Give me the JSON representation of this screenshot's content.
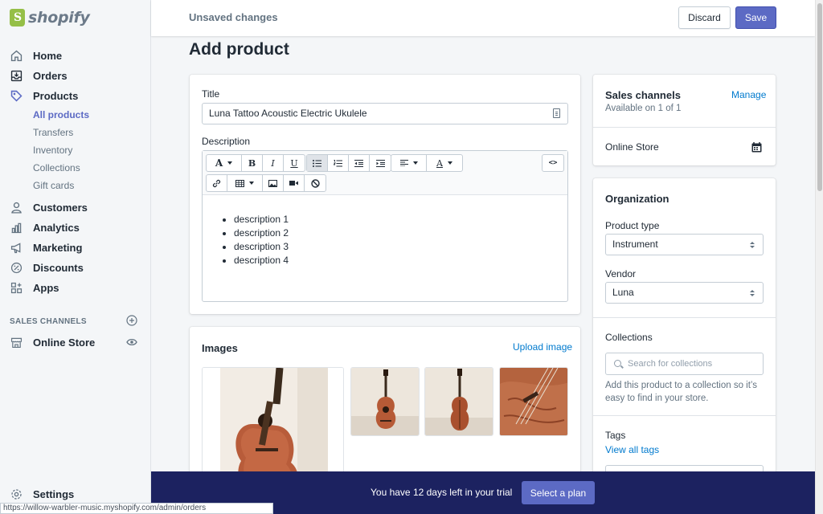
{
  "brand": {
    "name": "shopify"
  },
  "topbar": {
    "status": "Unsaved changes",
    "discard_label": "Discard",
    "save_label": "Save"
  },
  "sidebar": {
    "items": [
      {
        "label": "Home",
        "icon": "home-icon"
      },
      {
        "label": "Orders",
        "icon": "orders-icon"
      },
      {
        "label": "Products",
        "icon": "tag-icon"
      }
    ],
    "product_subitems": [
      "All products",
      "Transfers",
      "Inventory",
      "Collections",
      "Gift cards"
    ],
    "items2": [
      {
        "label": "Customers",
        "icon": "person-icon"
      },
      {
        "label": "Analytics",
        "icon": "bar-chart-icon"
      },
      {
        "label": "Marketing",
        "icon": "megaphone-icon"
      },
      {
        "label": "Discounts",
        "icon": "discount-icon"
      },
      {
        "label": "Apps",
        "icon": "apps-icon"
      }
    ],
    "sales_channels_heading": "SALES CHANNELS",
    "online_store_label": "Online Store",
    "settings_label": "Settings"
  },
  "status_url": "https://willow-warbler-music.myshopify.com/admin/orders",
  "page": {
    "title": "Add product"
  },
  "product": {
    "title_label": "Title",
    "title_value": "Luna Tattoo Acoustic Electric Ukulele",
    "description_label": "Description",
    "description_items": [
      "description 1",
      "description 2",
      "description 3",
      "description 4"
    ]
  },
  "images": {
    "heading": "Images",
    "upload_label": "Upload image"
  },
  "sales_channels": {
    "heading": "Sales channels",
    "manage_label": "Manage",
    "availability": "Available on 1 of 1",
    "channel": "Online Store"
  },
  "organization": {
    "heading": "Organization",
    "product_type_label": "Product type",
    "product_type_value": "Instrument",
    "vendor_label": "Vendor",
    "vendor_value": "Luna",
    "collections_label": "Collections",
    "collections_placeholder": "Search for collections",
    "collections_help": "Add this product to a collection so it’s easy to find in your store.",
    "tags_label": "Tags",
    "view_tags_label": "View all tags"
  },
  "trial": {
    "message": "You have 12 days left in your trial",
    "plan_label": "Select a plan"
  },
  "colors": {
    "accent": "#5c6ac4",
    "link": "#007ace",
    "banner": "#1c2260",
    "brand_green": "#95bf47"
  }
}
